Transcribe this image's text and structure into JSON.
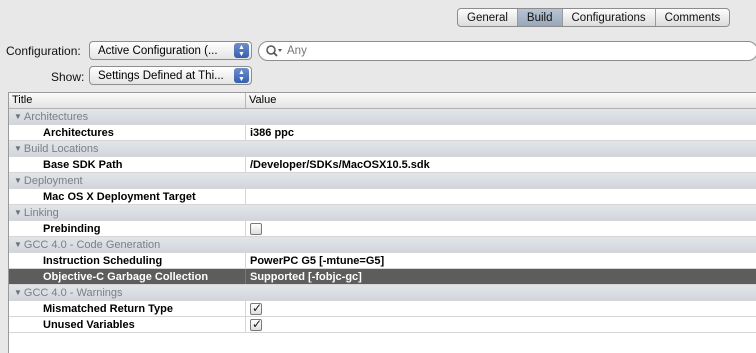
{
  "tabs": [
    {
      "label": "General",
      "selected": false
    },
    {
      "label": "Build",
      "selected": true
    },
    {
      "label": "Configurations",
      "selected": false
    },
    {
      "label": "Comments",
      "selected": false
    }
  ],
  "configuration": {
    "label": "Configuration:",
    "value": "Active Configuration (..."
  },
  "show": {
    "label": "Show:",
    "value": "Settings Defined at Thi..."
  },
  "search": {
    "placeholder": "Any",
    "icon": "search-icon"
  },
  "table": {
    "columns": [
      "Title",
      "Value"
    ],
    "groups": [
      {
        "title": "Architectures",
        "rows": [
          {
            "title": "Architectures",
            "value": "i386 ppc",
            "checkbox": null
          }
        ]
      },
      {
        "title": "Build Locations",
        "rows": [
          {
            "title": "Base SDK Path",
            "value": "/Developer/SDKs/MacOSX10.5.sdk",
            "checkbox": null
          }
        ]
      },
      {
        "title": "Deployment",
        "rows": [
          {
            "title": "Mac OS X Deployment Target",
            "value": "",
            "checkbox": null
          }
        ]
      },
      {
        "title": "Linking",
        "rows": [
          {
            "title": "Prebinding",
            "value": "",
            "checkbox": false
          }
        ]
      },
      {
        "title": "GCC 4.0 - Code Generation",
        "rows": [
          {
            "title": "Instruction Scheduling",
            "value": "PowerPC G5 [-mtune=G5]",
            "checkbox": null
          },
          {
            "title": "Objective-C Garbage Collection",
            "value": "Supported [-fobjc-gc]",
            "checkbox": null,
            "selected": true
          }
        ]
      },
      {
        "title": "GCC 4.0 - Warnings",
        "rows": [
          {
            "title": "Mismatched Return Type",
            "value": "",
            "checkbox": true
          },
          {
            "title": "Unused Variables",
            "value": "",
            "checkbox": true
          }
        ]
      }
    ]
  }
}
